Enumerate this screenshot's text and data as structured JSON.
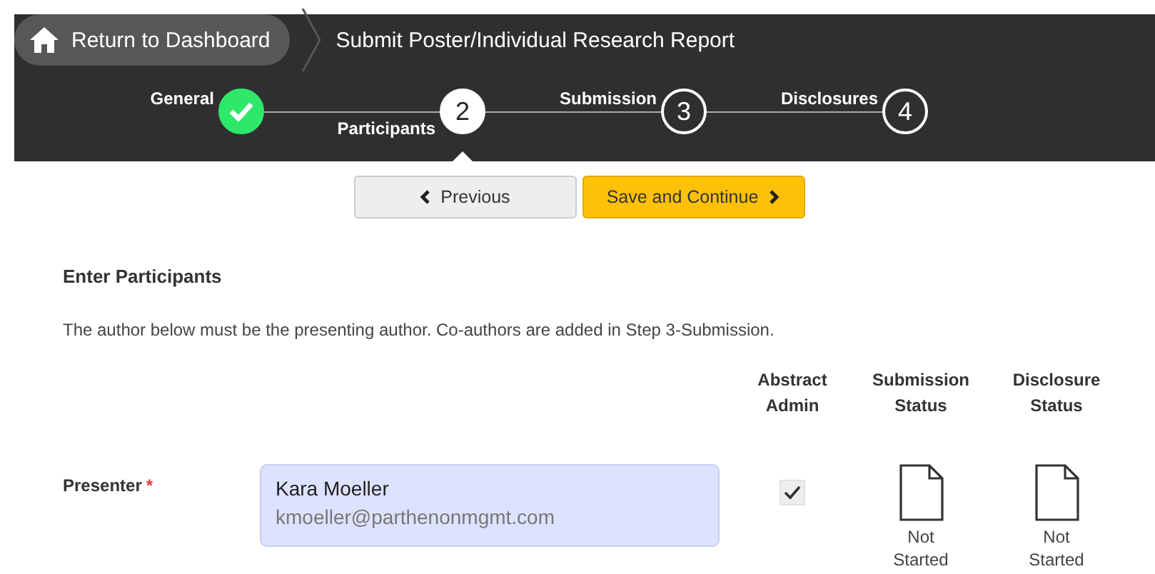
{
  "header": {
    "home_button": "Return to Dashboard",
    "page_title": "Submit Poster/Individual Research Report"
  },
  "steps": [
    {
      "label": "General",
      "completed": true,
      "selected": false
    },
    {
      "label": "Participants",
      "number": "2",
      "completed": false,
      "selected": true
    },
    {
      "label": "Submission",
      "number": "3",
      "completed": false,
      "selected": false
    },
    {
      "label": "Disclosures",
      "number": "4",
      "completed": false,
      "selected": false
    }
  ],
  "nav_buttons": [
    {
      "label": "Previous",
      "kind": "previous"
    },
    {
      "label": "Save and Continue",
      "kind": "next"
    }
  ],
  "section": {
    "heading": "Enter Participants",
    "instructions": "The author below must be the presenting author. Co-authors are added in Step 3-Submission."
  },
  "table": {
    "columns": [
      "Abstract Admin",
      "Submission Status",
      "Disclosure Status"
    ],
    "rows": [
      {
        "role": "Presenter",
        "required": true,
        "required_mark": "*",
        "name": "Kara Moeller",
        "email": "kmoeller@parthenonmgmt.com",
        "abstract_admin": true,
        "submission_status": "Not Started",
        "disclosure_status": "Not Started"
      }
    ]
  }
}
